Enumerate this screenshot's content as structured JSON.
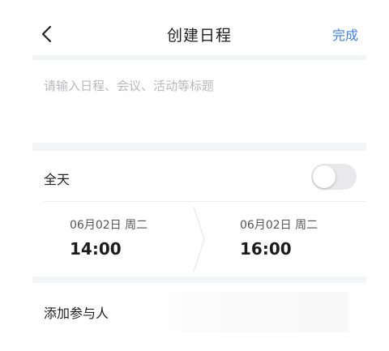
{
  "header": {
    "back_icon": "chevron-left-icon",
    "title": "创建日程",
    "done_label": "完成"
  },
  "title_field": {
    "placeholder": "请输入日程、会议、活动等标题",
    "value": ""
  },
  "all_day": {
    "label": "全天",
    "enabled": false
  },
  "time": {
    "start": {
      "date": "06月02日 周二",
      "time": "14:00"
    },
    "end": {
      "date": "06月02日 周二",
      "time": "16:00"
    }
  },
  "attendees": {
    "label": "添加参与人"
  },
  "colors": {
    "accent": "#3b7ef2",
    "background_gap": "#f4f5f7",
    "placeholder": "#b8b9bd"
  }
}
